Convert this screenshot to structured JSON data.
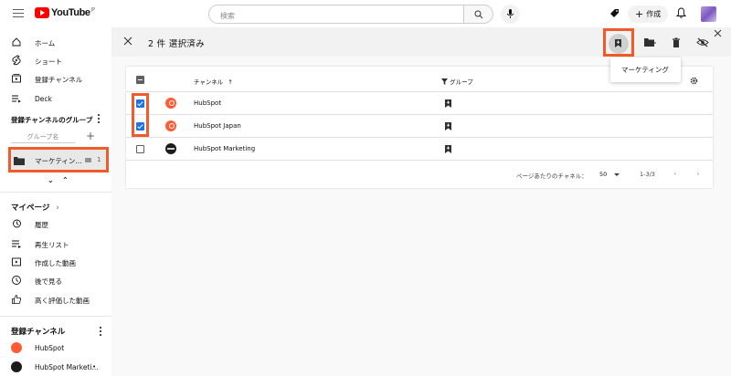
{
  "header": {
    "logo_text": "YouTube",
    "logo_region": "JP",
    "search_placeholder": "検索",
    "create_label": "作成",
    "accent_color": "#ff0000"
  },
  "sidebar": {
    "nav": [
      {
        "label": "ホーム",
        "icon": "home-icon"
      },
      {
        "label": "ショート",
        "icon": "shorts-icon"
      },
      {
        "label": "登録チャンネル",
        "icon": "subscriptions-icon"
      },
      {
        "label": "Deck",
        "icon": "deck-icon"
      }
    ],
    "groups_title": "登録チャンネルのグループ",
    "group_input_placeholder": "グループ名",
    "group": {
      "name": "マーケティン...",
      "count": "1"
    },
    "mypage_title": "マイページ",
    "mypage_items": [
      {
        "label": "履歴",
        "icon": "history-icon"
      },
      {
        "label": "再生リスト",
        "icon": "playlist-icon"
      },
      {
        "label": "作成した動画",
        "icon": "your-videos-icon"
      },
      {
        "label": "後で見る",
        "icon": "watch-later-icon"
      },
      {
        "label": "高く評価した動画",
        "icon": "liked-icon"
      }
    ],
    "subs_title": "登録チャンネル",
    "subs": [
      {
        "label": "HubSpot"
      },
      {
        "label": "HubSpot Marketi..."
      }
    ]
  },
  "selection": {
    "title": "2 件 選択済み",
    "tooltip": "マーケティング"
  },
  "table": {
    "headers": {
      "channel": "チャンネル",
      "group": "グループ"
    },
    "rows": [
      {
        "name": "HubSpot",
        "checked": true,
        "logo": "hubspot"
      },
      {
        "name": "HubSpot Japan",
        "checked": true,
        "logo": "hubspot"
      },
      {
        "name": "HubSpot Marketing",
        "checked": false,
        "logo": "dark"
      }
    ],
    "footer": {
      "per_page_label": "ページあたりのチャネル：",
      "per_page_value": "50",
      "range": "1-3/3"
    }
  },
  "highlight_color": "#f15a2b"
}
